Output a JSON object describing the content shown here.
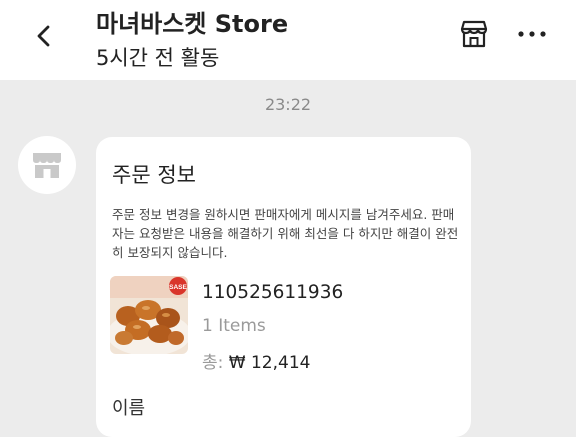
{
  "header": {
    "title": "마녀바스켓 Store",
    "status": "5시간 전 활동",
    "back_icon": "back-arrow-icon",
    "store_icon": "storefront-icon",
    "more_icon": "more-dots-icon"
  },
  "chat": {
    "timestamp": "23:22",
    "avatar_icon": "store-avatar-icon"
  },
  "order_card": {
    "title": "주문 정보",
    "notice": "주문 정보 변경을 원하시면 판매자에게 메시지를 남겨주세요. 판매자는 요청받은 내용을 해결하기 위해 최선을 다 하지만 해결이 완전히 보장되지 않습니다.",
    "order_number": "110525611936",
    "items": "1 Items",
    "total_label": "총:",
    "total_value": "₩ 12,414",
    "name_label": "이름",
    "product_badge": "SASE"
  },
  "colors": {
    "background": "#ececec",
    "card": "#ffffff",
    "muted_text": "#9a9a9a"
  }
}
